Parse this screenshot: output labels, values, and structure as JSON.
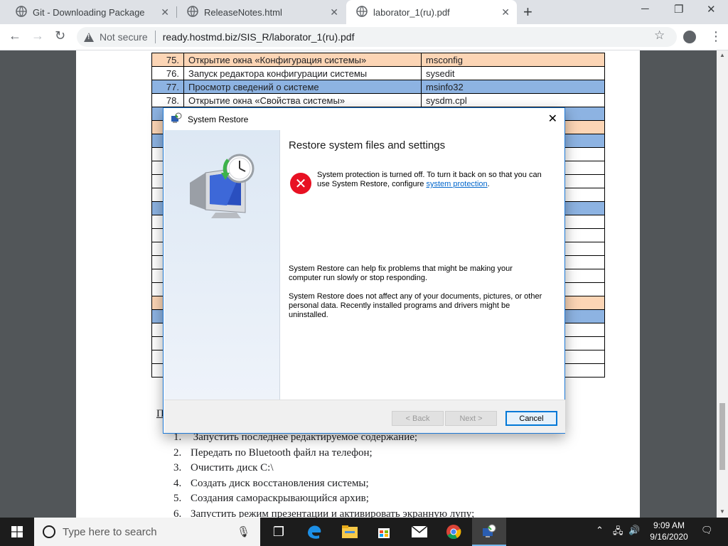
{
  "browser": {
    "tabs": [
      {
        "title": "Git - Downloading Package",
        "active": false
      },
      {
        "title": "ReleaseNotes.html",
        "active": false
      },
      {
        "title": "laborator_1(ru).pdf",
        "active": true
      }
    ],
    "security_label": "Not secure",
    "url": "ready.hostmd.biz/SIS_R/laborator_1(ru).pdf"
  },
  "pdf": {
    "table_rows": [
      {
        "num": "75.",
        "desc": "Открытие окна «Конфигурация системы»",
        "cmd": "msconfig",
        "color": "peach"
      },
      {
        "num": "76.",
        "desc": "Запуск редактора конфигурации системы",
        "cmd": "sysedit",
        "color": "white"
      },
      {
        "num": "77.",
        "desc": "Просмотр сведений о системе",
        "cmd": "msinfo32",
        "color": "blue"
      },
      {
        "num": "78.",
        "desc": "Открытие окна «Свойства системы»",
        "cmd": "sysdm.cpl",
        "color": "white"
      },
      {
        "num": "",
        "desc": "",
        "cmd": "",
        "color": "blue"
      },
      {
        "num": "",
        "desc": "",
        "cmd": "",
        "color": "peach"
      },
      {
        "num": "",
        "desc": "",
        "cmd": "",
        "color": "blue"
      },
      {
        "num": "",
        "desc": "",
        "cmd": "",
        "color": "white"
      },
      {
        "num": "",
        "desc": "",
        "cmd": "",
        "color": "white"
      },
      {
        "num": "",
        "desc": "",
        "cmd": "",
        "color": "white"
      },
      {
        "num": "",
        "desc": "",
        "cmd": "",
        "color": "white"
      },
      {
        "num": "",
        "desc": "",
        "cmd": "",
        "color": "blue"
      },
      {
        "num": "",
        "desc": "",
        "cmd": "",
        "color": "white"
      },
      {
        "num": "",
        "desc": "",
        "cmd": "",
        "color": "white"
      },
      {
        "num": "",
        "desc": "",
        "cmd": "",
        "color": "white"
      },
      {
        "num": "",
        "desc": "",
        "cmd": "",
        "color": "white"
      },
      {
        "num": "",
        "desc": "",
        "cmd": "",
        "color": "white"
      },
      {
        "num": "",
        "desc": "",
        "cmd": "",
        "color": "white"
      },
      {
        "num": "",
        "desc": "",
        "cmd": "",
        "color": "peach"
      },
      {
        "num": "",
        "desc": "",
        "cmd": "",
        "color": "blue"
      },
      {
        "num": "",
        "desc": "",
        "cmd": "",
        "color": "white"
      },
      {
        "num": "",
        "desc": "",
        "cmd": "",
        "color": "white"
      },
      {
        "num": "",
        "desc": "",
        "cmd": "",
        "color": "white"
      },
      {
        "num": "",
        "desc": "",
        "cmd": "",
        "color": "white"
      }
    ],
    "cut_text": "П",
    "tasks": [
      {
        "num": "1.",
        "text": " Запустить последнее редактируемое содержание;"
      },
      {
        "num": "2.",
        "text": "Передать по Bluetooth файл на телефон;"
      },
      {
        "num": "3.",
        "text": "Очистить диск С:\\"
      },
      {
        "num": "4.",
        "text": "Создать диск восстановления системы;"
      },
      {
        "num": "5.",
        "text": "Создания самораскрывающийся архив;"
      },
      {
        "num": "6.",
        "text": "Запустить режим презентации и активировать экранную лупу;"
      }
    ]
  },
  "dialog": {
    "title": "System Restore",
    "heading": "Restore system files and settings",
    "error_text": "System protection is turned off. To turn it back on so that you can use System Restore, configure ",
    "error_link": "system protection",
    "error_end": ".",
    "info1": "System Restore can help fix problems that might be making your computer run slowly or stop responding.",
    "info2": "System Restore does not affect any of your documents, pictures, or other personal data. Recently installed programs and drivers might be uninstalled.",
    "back_label": "< Back",
    "next_label": "Next >",
    "cancel_label": "Cancel"
  },
  "taskbar": {
    "search_placeholder": "Type here to search",
    "time": "9:09 AM",
    "date": "9/16/2020"
  },
  "colors": {
    "peach": "#fcd5b5",
    "blue": "#8db3e2",
    "accent": "#0078d7"
  }
}
